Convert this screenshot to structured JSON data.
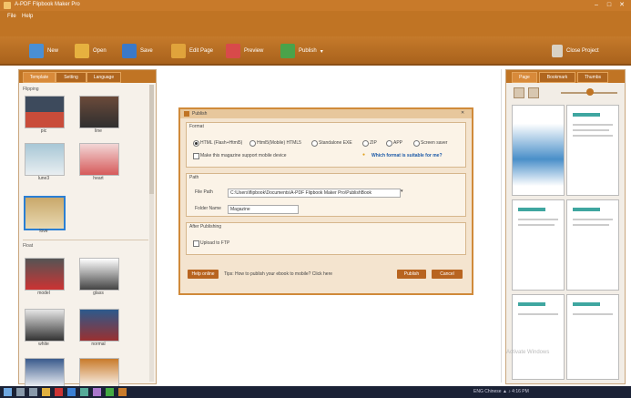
{
  "window": {
    "title": "A-PDF Flipbook Maker Pro",
    "controls": [
      "–",
      "□",
      "✕"
    ]
  },
  "menu": {
    "items": [
      "File",
      "Help"
    ]
  },
  "toolbar": {
    "buttons": [
      {
        "label": "New",
        "icon": "new-icon",
        "color": "#4a8fd4"
      },
      {
        "label": "Open",
        "icon": "open-icon",
        "color": "#e6b13f"
      },
      {
        "label": "Save",
        "icon": "save-icon",
        "color": "#3a79c8"
      },
      {
        "label": "Edit Page",
        "icon": "edit-page-icon",
        "color": "#e0a33b"
      },
      {
        "label": "Preview",
        "icon": "preview-icon",
        "color": "#d84a4a"
      },
      {
        "label": "Publish",
        "icon": "publish-icon",
        "color": "#4aa34a"
      }
    ],
    "close_project": "Close Project"
  },
  "left": {
    "tabs": [
      "Template",
      "Setting",
      "Language"
    ],
    "group1": "Flipping",
    "group2": "Float",
    "thumbs1": [
      "pic",
      "line",
      "lune3",
      "heart",
      "love"
    ],
    "thumbs2": [
      "model",
      "glass",
      "white",
      "normal"
    ]
  },
  "dialog": {
    "title": "Publish",
    "format_label": "Format",
    "formats": [
      "HTML (Flash+Html5)",
      "Html5(Mobile) HTML5",
      "Standalone EXE",
      "ZIP",
      "APP",
      "Screen saver"
    ],
    "mobile_check": "Make this magazine support mobile device",
    "which_format": "Which format is suitable for me?",
    "path_label": "Path",
    "file_path_label": "File Path",
    "file_path": "C:\\Users\\flipbook\\Documents\\A-PDF Flipbook Maker Pro\\PublishBook",
    "folder_label": "Folder Name",
    "folder_name": "Magazine",
    "after_label": "After Publishing",
    "upload_check": "Upload to FTP",
    "help_btn": "Help online",
    "tips": "Tips: How to publish your ebook to mobile? Click here",
    "publish_btn": "Publish",
    "cancel_btn": "Cancel"
  },
  "right": {
    "tabs": [
      "Page",
      "Bookmark",
      "Thumbs"
    ]
  },
  "taskbar": {
    "tray": "ENG  Chinese  ▲  ♪  4:16 PM  ",
    "watermark": "Activate Windows",
    "icons": [
      "start-icon",
      "search-icon",
      "taskview-icon",
      "explorer-icon",
      "browser-icon",
      "mail-icon",
      "store-icon",
      "app-icon",
      "chrome-icon",
      "flipbook-icon"
    ]
  },
  "colors": {
    "accent": "#c07424",
    "dialog_border": "#d08a3a",
    "selection": "#2a7fd4"
  }
}
